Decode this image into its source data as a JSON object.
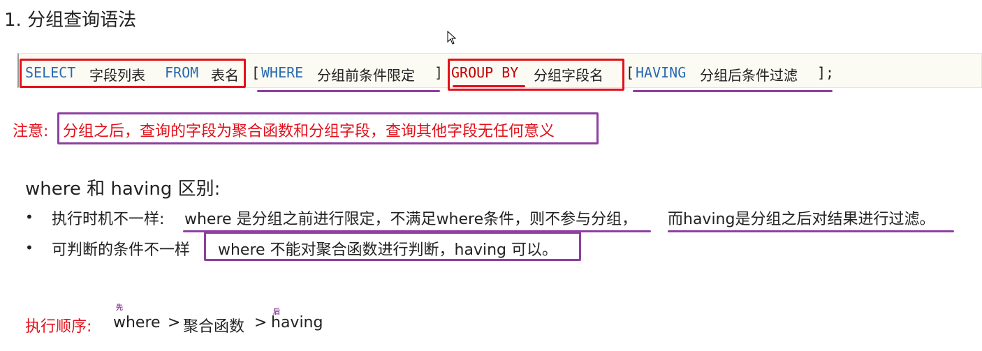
{
  "heading": "1. 分组查询语法",
  "syntax": {
    "select_kw": "SELECT",
    "fields": "字段列表",
    "from_kw": "FROM",
    "table": "表名",
    "open1": "[",
    "where_kw": "WHERE",
    "where_desc": "分组前条件限定",
    "close1": "]",
    "groupby_kw": "GROUP BY",
    "groupby_desc": "分组字段名",
    "open2": "[",
    "having_kw": "HAVING",
    "having_desc": "分组后条件过滤",
    "close2": "];"
  },
  "note": {
    "label": "注意:",
    "text": "分组之后，查询的字段为聚合函数和分组字段，查询其他字段无任何意义"
  },
  "diff": {
    "title": "where 和 having 区别:",
    "items": [
      {
        "bullet": "•",
        "label": "执行时机不一样:",
        "part1": "where 是分组之前进行限定，不满足where条件，则不参与分组，",
        "part2": "而having是分组之后对结果进行过滤。"
      },
      {
        "bullet": "•",
        "label": "可判断的条件不一样",
        "part1": "where 不能对聚合函数进行判断，having 可以。"
      }
    ]
  },
  "order": {
    "label": "执行顺序:",
    "first_mark": "先",
    "last_mark": "后",
    "step1": "where",
    "sep1": ">",
    "step2": "聚合函数",
    "sep2": ">",
    "step3": "having"
  },
  "colors": {
    "keyword": "#2a6bb0",
    "highlight_red": "#e3101a",
    "highlight_purple": "#8e3fa0"
  },
  "icons": [
    "mouse-cursor-icon"
  ]
}
